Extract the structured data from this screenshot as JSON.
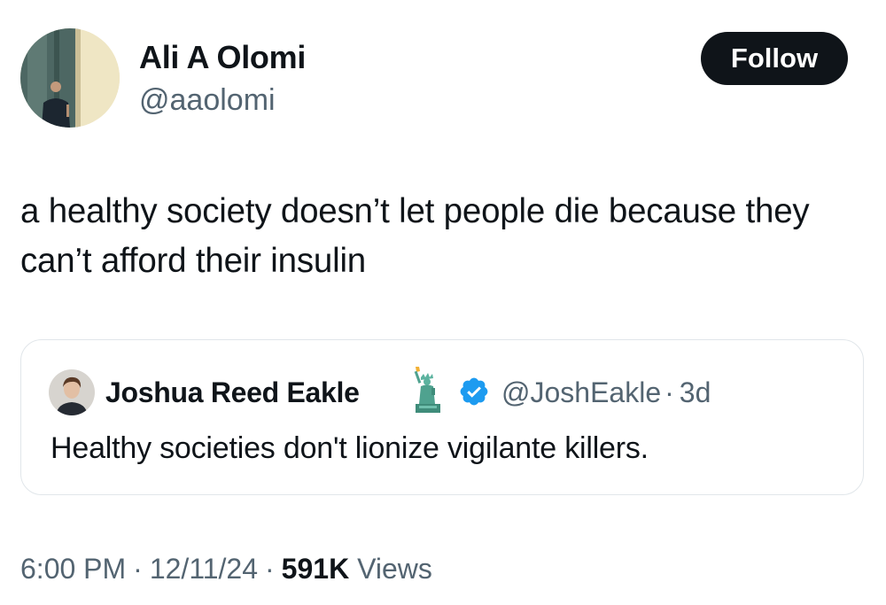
{
  "author": {
    "display_name": "Ali A Olomi",
    "handle": "@aaolomi",
    "avatar_icon": "profile-photo-speaker"
  },
  "follow_label": "Follow",
  "tweet_text": "a healthy society doesn’t let people die because they can’t afford their insulin",
  "quote": {
    "display_name": "Joshua Reed Eakle",
    "badge_icon": "statue-of-liberty-emoji",
    "verified_icon": "verified-badge-icon",
    "handle": "@JoshEakle",
    "separator": "·",
    "age": "3d",
    "text": "Healthy societies don't lionize vigilante killers."
  },
  "footer": {
    "time": "6:00 PM",
    "date": "12/11/24",
    "separator": "·",
    "views_count": "591K",
    "views_label": "Views"
  },
  "colors": {
    "text": "#0f1419",
    "secondary": "#536471",
    "verified": "#1d9bf0",
    "button_bg": "#0f1419",
    "border": "#e1e6ea"
  }
}
